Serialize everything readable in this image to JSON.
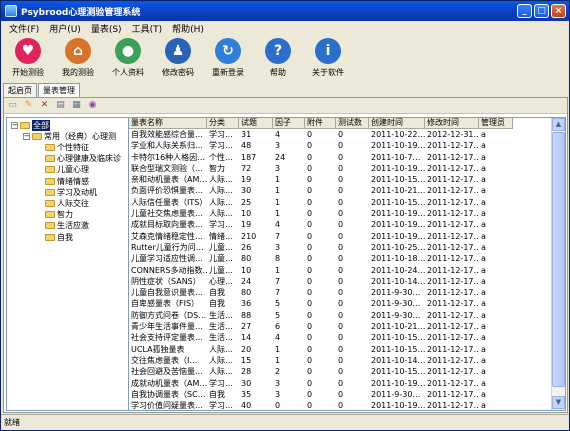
{
  "window": {
    "title": "Psybrood心理测验管理系统"
  },
  "menu": [
    "文件(F)",
    "用户(U)",
    "量表(S)",
    "工具(T)",
    "帮助(H)"
  ],
  "toolbar": [
    {
      "label": "开始测验",
      "icon": "heart-icon",
      "color": "#e0245e",
      "glyph": "♥"
    },
    {
      "label": "我的测验",
      "icon": "house-icon",
      "color": "#d9722b",
      "glyph": "⌂"
    },
    {
      "label": "个人资料",
      "icon": "chat-bubbles-icon",
      "color": "#3ba05a",
      "glyph": "●"
    },
    {
      "label": "修改密码",
      "icon": "user-key-icon",
      "color": "#2a62b8",
      "glyph": "♟"
    },
    {
      "label": "重新登录",
      "icon": "refresh-icon",
      "color": "#2f7fd6",
      "glyph": "↻"
    },
    {
      "label": "帮助",
      "icon": "help-icon",
      "color": "#2b6fcc",
      "glyph": "?"
    },
    {
      "label": "关于软件",
      "icon": "info-icon",
      "color": "#2b6fcc",
      "glyph": "i"
    }
  ],
  "tabs": [
    "起启页",
    "量表管理"
  ],
  "tree": {
    "root": "全部",
    "group": "常用（经典）心理测",
    "children": [
      "个性特征",
      "心理健康及临床诊",
      "儿童心理",
      "情绪情感",
      "学习及动机",
      "人际交往",
      "智力",
      "生活应激",
      "自我"
    ]
  },
  "grid": {
    "columns": [
      "量表名称",
      "分类",
      "试题",
      "因子",
      "附件",
      "测试数",
      "创建时间",
      "修改时间",
      "管理员"
    ],
    "rows": [
      [
        "自我效能感综合量…",
        "学习…",
        "31",
        "4",
        "0",
        "0",
        "2011-10-22…",
        "2012-12-31…",
        "a"
      ],
      [
        "学业和人际关系归…",
        "学习…",
        "48",
        "3",
        "0",
        "0",
        "2011-10-19…",
        "2011-12-17…",
        "a"
      ],
      [
        "卡特尔16种人格因…",
        "个性…",
        "187",
        "24",
        "0",
        "0",
        "2011-10-7…",
        "2011-12-17…",
        "a"
      ],
      [
        "联合型瑞文测验（…",
        "智力",
        "72",
        "3",
        "0",
        "0",
        "2011-10-19…",
        "2011-12-17…",
        "a"
      ],
      [
        "亲和动机量表（AM…",
        "人际…",
        "19",
        "1",
        "0",
        "0",
        "2011-10-15…",
        "2011-12-17…",
        "a"
      ],
      [
        "负面评价恐惧量表…",
        "人际…",
        "30",
        "1",
        "0",
        "0",
        "2011-10-21…",
        "2011-12-17…",
        "a"
      ],
      [
        "人际信任量表（ITS）",
        "人际…",
        "25",
        "1",
        "0",
        "0",
        "2011-10-15…",
        "2011-12-17…",
        "a"
      ],
      [
        "儿童社交焦虑量表…",
        "人际…",
        "10",
        "1",
        "0",
        "0",
        "2011-10-19…",
        "2011-12-17…",
        "a"
      ],
      [
        "成就目标取向量表…",
        "学习…",
        "19",
        "4",
        "0",
        "0",
        "2011-10-19…",
        "2011-12-17…",
        "a"
      ],
      [
        "艾森克情绪稳定性…",
        "情绪…",
        "210",
        "7",
        "0",
        "0",
        "2011-10-19…",
        "2011-12-17…",
        "a"
      ],
      [
        "Rutter儿童行为问…",
        "儿童…",
        "26",
        "3",
        "0",
        "0",
        "2011-10-25…",
        "2011-12-17…",
        "a"
      ],
      [
        "儿童学习适应性调…",
        "儿童…",
        "80",
        "8",
        "0",
        "0",
        "2011-10-18…",
        "2011-12-17…",
        "a"
      ],
      [
        "CONNERS多动指数…",
        "儿童…",
        "10",
        "1",
        "0",
        "0",
        "2011-10-24…",
        "2011-12-17…",
        "a"
      ],
      [
        "阴性症状（SANS）",
        "心理…",
        "24",
        "7",
        "0",
        "0",
        "2011-10-14…",
        "2011-12-17…",
        "a"
      ],
      [
        "儿童自我意识量表…",
        "自我",
        "80",
        "7",
        "0",
        "0",
        "2011-9-30…",
        "2011-12-17…",
        "a"
      ],
      [
        "自卑感量表（FIS）",
        "自我",
        "36",
        "5",
        "0",
        "0",
        "2011-9-30…",
        "2011-12-17…",
        "a"
      ],
      [
        "防御方式问卷（DS…",
        "生活…",
        "88",
        "5",
        "0",
        "0",
        "2011-9-30…",
        "2011-12-17…",
        "a"
      ],
      [
        "青少年生活事件量…",
        "生活…",
        "27",
        "6",
        "0",
        "0",
        "2011-10-21…",
        "2011-12-17…",
        "a"
      ],
      [
        "社会支持评定量表…",
        "生活…",
        "14",
        "4",
        "0",
        "0",
        "2011-10-15…",
        "2011-12-17…",
        "a"
      ],
      [
        "UCLA孤独量表",
        "人际…",
        "20",
        "1",
        "0",
        "0",
        "2011-10-15…",
        "2011-12-17…",
        "a"
      ],
      [
        "交往焦虑量表（I…",
        "人际…",
        "15",
        "1",
        "0",
        "0",
        "2011-10-14…",
        "2011-12-17…",
        "a"
      ],
      [
        "社会回避及苦恼量…",
        "人际…",
        "28",
        "2",
        "0",
        "0",
        "2011-10-15…",
        "2011-12-17…",
        "a"
      ],
      [
        "成就动机量表（AM…",
        "学习…",
        "30",
        "3",
        "0",
        "0",
        "2011-10-19…",
        "2011-12-17…",
        "a"
      ],
      [
        "自我协调量表（SC…",
        "自我",
        "35",
        "3",
        "0",
        "0",
        "2011-9-30…",
        "2011-12-17…",
        "a"
      ],
      [
        "学习价值问疑量表…",
        "学习…",
        "40",
        "0",
        "0",
        "0",
        "2011-10-19…",
        "2011-12-17…",
        "a"
      ]
    ]
  },
  "status": "就绪"
}
